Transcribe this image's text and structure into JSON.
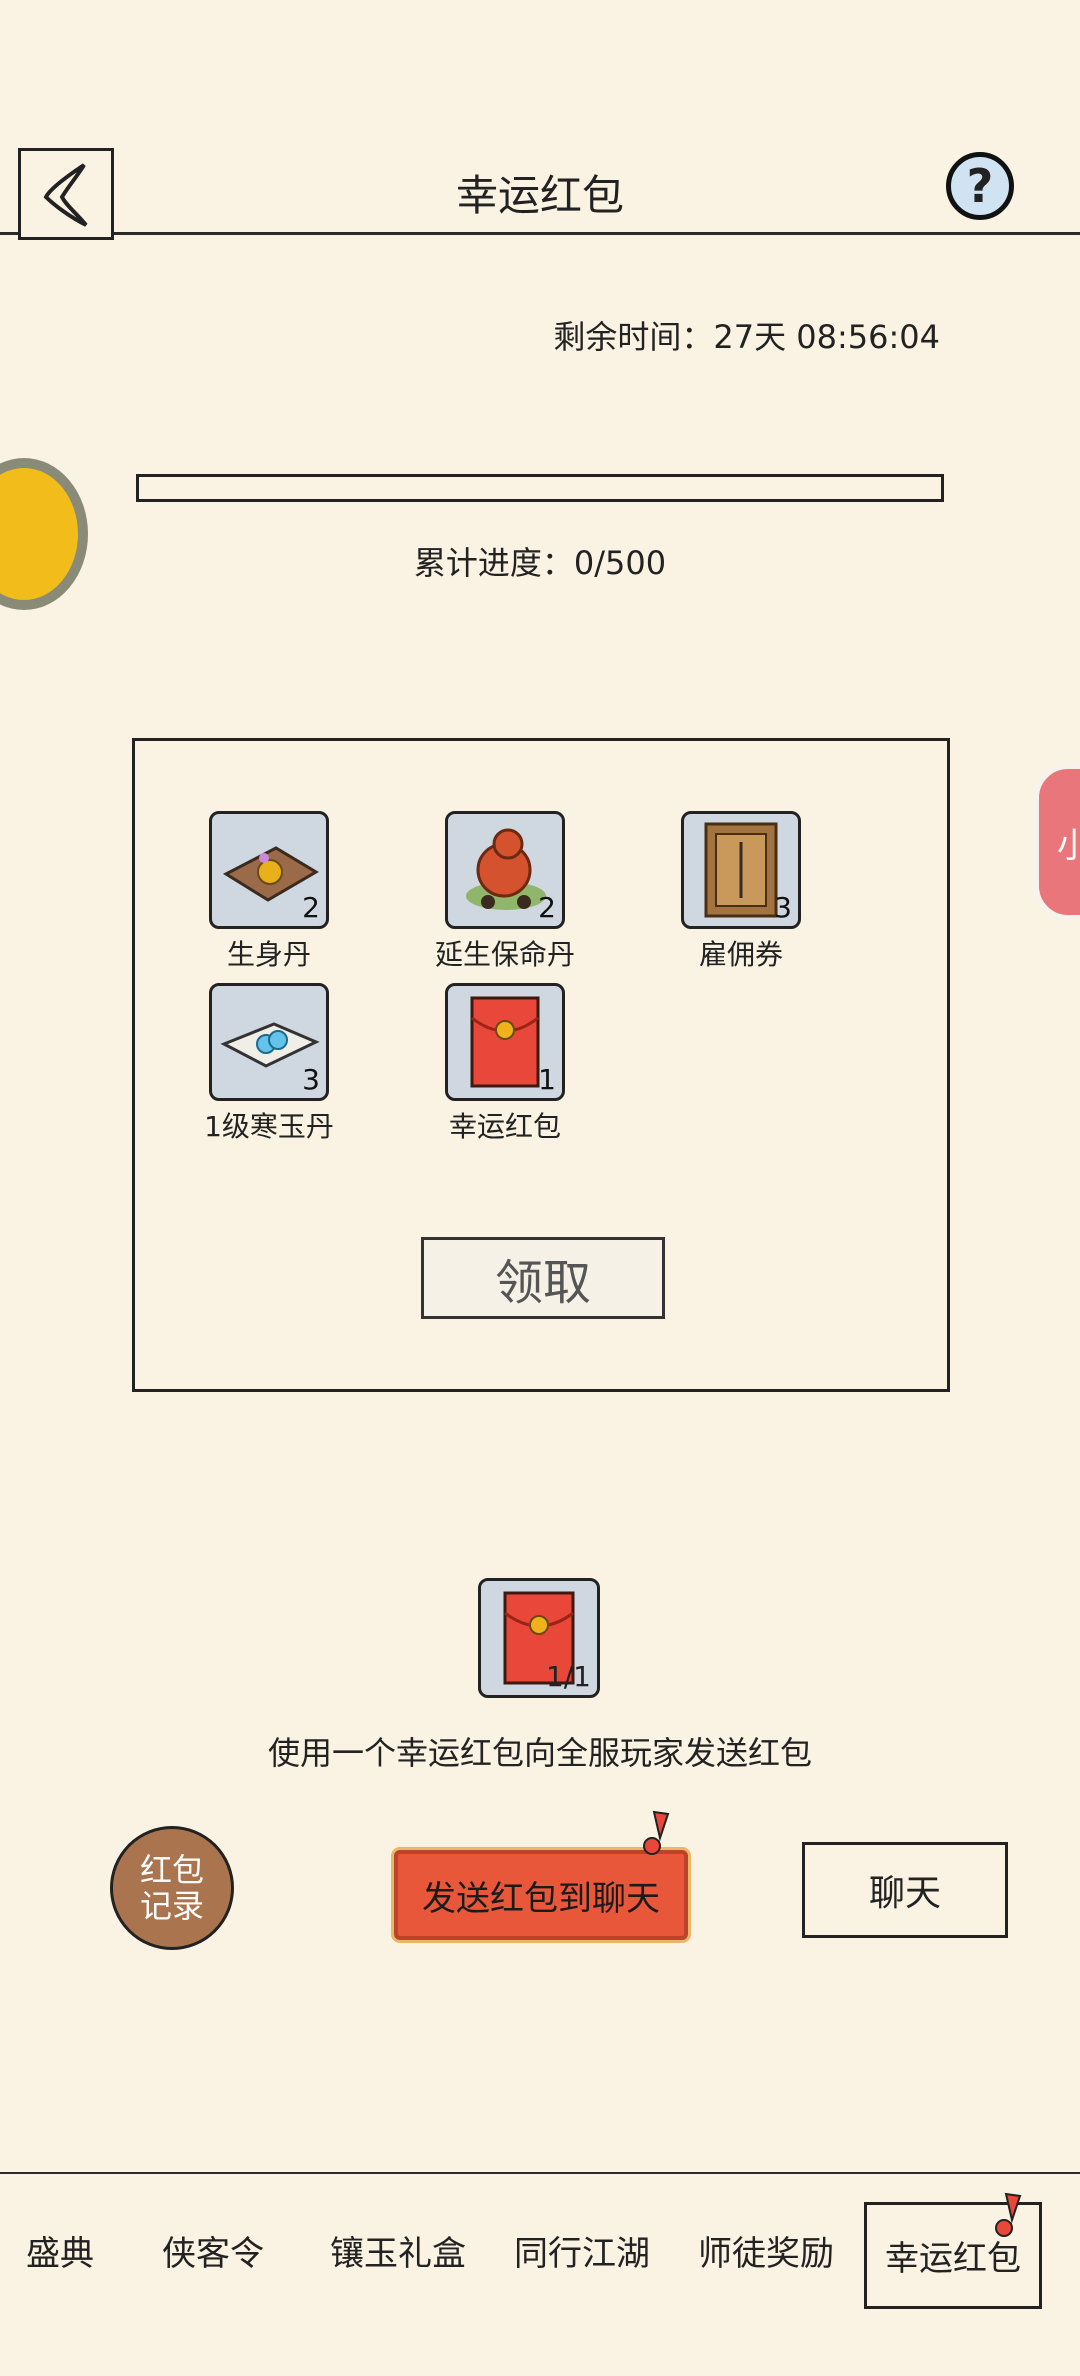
{
  "header": {
    "title": "幸运红包",
    "back_icon": "back-arrow-icon",
    "help_icon": "question-mark-icon",
    "help_glyph": "?"
  },
  "timer": {
    "label": "剩余时间：27天 08:56:04"
  },
  "progress": {
    "label": "累计进度：0/500",
    "current": 0,
    "max": 500,
    "fill_fraction": 0
  },
  "rewards": {
    "items": [
      {
        "label": "生身丹",
        "count": "2",
        "icon": "pill-on-cloth-icon"
      },
      {
        "label": "延生保命丹",
        "count": "2",
        "icon": "gourd-pills-icon"
      },
      {
        "label": "雇佣券",
        "count": "3",
        "icon": "hire-ticket-icon"
      },
      {
        "label": "1级寒玉丹",
        "count": "3",
        "icon": "jade-pill-icon"
      },
      {
        "label": "幸运红包",
        "count": "1",
        "icon": "red-envelope-icon"
      }
    ],
    "claim_label": "领取"
  },
  "send": {
    "icon": "red-envelope-icon",
    "count": "1/1",
    "description": "使用一个幸运红包向全服玩家发送红包",
    "send_label": "发送红包到聊天",
    "record_line1": "红包",
    "record_line2": "记录",
    "chat_label": "聊天"
  },
  "floating_tab_label": "小",
  "tabs": [
    {
      "label": "盛典"
    },
    {
      "label": "侠客令"
    },
    {
      "label": "镶玉礼盒"
    },
    {
      "label": "同行江湖"
    },
    {
      "label": "师徒奖励"
    },
    {
      "label": "幸运红包"
    }
  ],
  "colors": {
    "background": "#faf3e3",
    "accent_red": "#e8573a",
    "record_brown": "#a9744e"
  }
}
